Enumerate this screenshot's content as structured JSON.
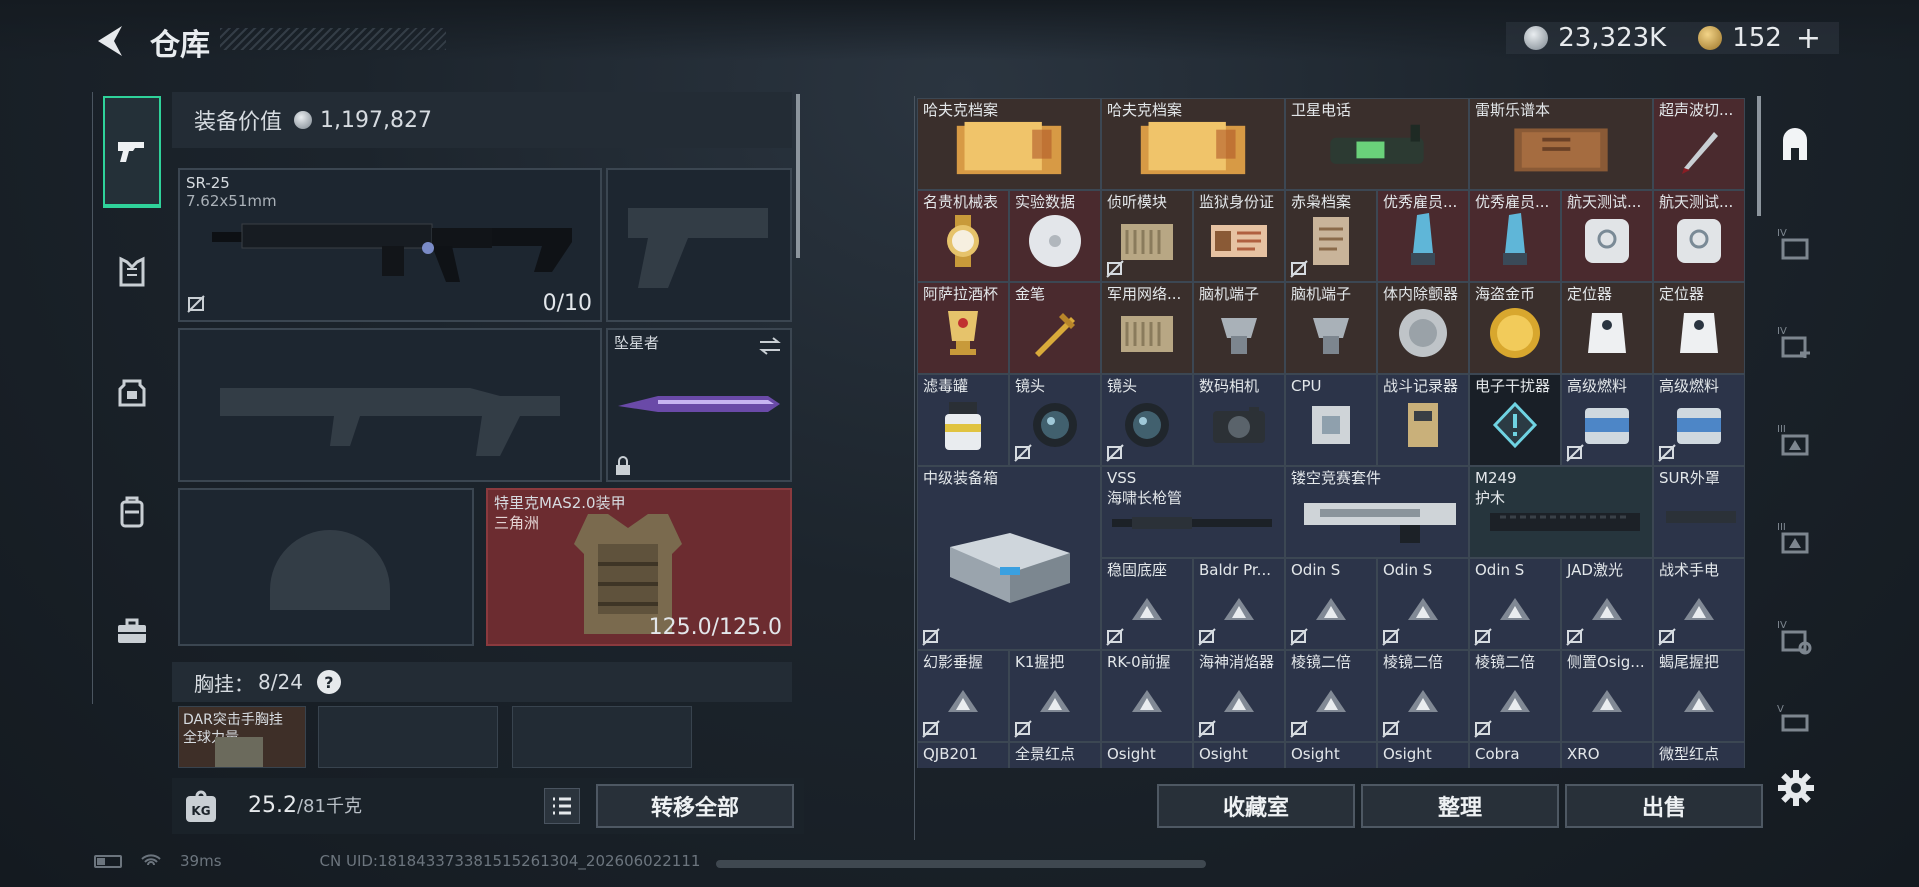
{
  "header": {
    "title": "仓库",
    "silver": "23,323K",
    "gold": "152"
  },
  "equip": {
    "value_label": "装备价值",
    "value": "1,197,827",
    "primary": {
      "name": "SR-25",
      "ammo": "7.62x51mm",
      "mag": "0/10"
    },
    "melee": {
      "name": "坠星者"
    },
    "armor": {
      "name": "特里克MAS2.0装甲",
      "sub": "三角洲",
      "durability": "125.0/125.0"
    },
    "chest_label": "胸挂：",
    "chest_capacity": "8/24",
    "chest_item": {
      "name": "DAR突击手胸挂",
      "sub": "全球力量"
    },
    "weight": "25.2",
    "weight_max": "/81千克",
    "transfer_all": "转移全部"
  },
  "stash": {
    "rows": [
      [
        {
          "n": "哈夫克档案",
          "c": "brown",
          "w": 2,
          "art": "folder"
        },
        {
          "n": "哈夫克档案",
          "c": "brown",
          "w": 2,
          "art": "folder"
        },
        {
          "n": "卫星电话",
          "c": "brown",
          "w": 2,
          "art": "phone"
        },
        {
          "n": "雷斯乐谱本",
          "c": "brown",
          "w": 2,
          "art": "book"
        },
        {
          "n": "超声波切...",
          "c": "maroon",
          "w": 1,
          "art": "knife"
        }
      ],
      [
        {
          "n": "名贵机械表",
          "c": "maroon",
          "art": "watch"
        },
        {
          "n": "实验数据",
          "c": "maroon",
          "art": "disc"
        },
        {
          "n": "侦听模块",
          "c": "brown",
          "art": "module",
          "t": 1
        },
        {
          "n": "监狱身份证",
          "c": "brown",
          "art": "card"
        },
        {
          "n": "赤枭档案",
          "c": "brown",
          "art": "file",
          "t": 1
        },
        {
          "n": "优秀雇员...",
          "c": "maroon",
          "art": "trophy"
        },
        {
          "n": "优秀雇员...",
          "c": "maroon",
          "art": "trophy"
        },
        {
          "n": "航天测试...",
          "c": "maroon",
          "art": "device"
        },
        {
          "n": "航天测试...",
          "c": "maroon",
          "art": "device"
        }
      ],
      [
        {
          "n": "阿萨拉酒杯",
          "c": "maroon",
          "art": "cup"
        },
        {
          "n": "金笔",
          "c": "maroon",
          "art": "pen"
        },
        {
          "n": "军用网络...",
          "c": "brown",
          "art": "module"
        },
        {
          "n": "脑机端子",
          "c": "brown",
          "art": "clip"
        },
        {
          "n": "脑机端子",
          "c": "brown",
          "art": "clip"
        },
        {
          "n": "体内除颤器",
          "c": "brown",
          "art": "round"
        },
        {
          "n": "海盗金币",
          "c": "brown",
          "art": "goldcoin"
        },
        {
          "n": "定位器",
          "c": "brown",
          "art": "tag"
        },
        {
          "n": "定位器",
          "c": "brown",
          "art": "tag"
        }
      ],
      [
        {
          "n": "滤毒罐",
          "c": "navy",
          "art": "canister"
        },
        {
          "n": "镜头",
          "c": "navy",
          "art": "lens",
          "t": 1
        },
        {
          "n": "镜头",
          "c": "navy",
          "art": "lens",
          "t": 1
        },
        {
          "n": "数码相机",
          "c": "navy",
          "art": "camera"
        },
        {
          "n": "CPU",
          "c": "navy",
          "art": "cpu"
        },
        {
          "n": "战斗记录器",
          "c": "navy",
          "art": "recorder"
        },
        {
          "n": "电子干扰器",
          "c": "dark",
          "art": "jammer"
        },
        {
          "n": "高级燃料",
          "c": "navy",
          "art": "fuel",
          "t": 1
        },
        {
          "n": "高级燃料",
          "c": "navy",
          "art": "fuel",
          "t": 1
        }
      ]
    ],
    "big_case": {
      "n": "中级装备箱"
    },
    "vss": {
      "n": "VSS",
      "n2": "海啸长枪管"
    },
    "slide": {
      "n": "镂空竞赛套件"
    },
    "m249": {
      "n": "M249",
      "n2": "护木"
    },
    "sur": {
      "n": "SUR外罩"
    },
    "attach1": [
      "稳固底座",
      "Baldr Pr...",
      "Odin S",
      "Odin S",
      "Odin S",
      "JAD激光",
      "战术手电"
    ],
    "attach2": [
      "幻影垂握",
      "K1握把",
      "RK-0前握",
      "海神消焰器",
      "棱镜二倍",
      "棱镜二倍",
      "棱镜二倍",
      "侧置Osig...",
      "蝎尾握把"
    ],
    "attach3": [
      "QJB201",
      "全景红点",
      "Osight",
      "Osight",
      "Osight",
      "Osight",
      "Cobra",
      "XRO",
      "微型红点"
    ],
    "buttons": {
      "collection": "收藏室",
      "sort": "整理",
      "sell": "出售"
    }
  },
  "status": {
    "ping": "39ms",
    "uid": "CN UID:181843373381515261304_202606022111"
  },
  "colors": {
    "accent": "#2fd29a",
    "red_slot": "#6c2c30",
    "tile_brown": "#3a2f2c",
    "tile_maroon": "#4a2a2e",
    "tile_navy": "#2c3449"
  }
}
